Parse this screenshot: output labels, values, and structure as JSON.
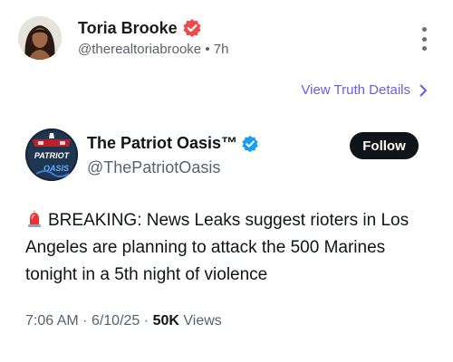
{
  "post": {
    "author_name": "Toria Brooke",
    "author_handle": "@therealtoriabrooke",
    "separator": "•",
    "time_ago": "7h",
    "more_icon": "more-vertical-icon",
    "verified_icon": "verified-badge-icon",
    "verified_color": "#ec4c4c"
  },
  "truth_link": {
    "label": "View Truth Details",
    "icon": "chevron-right-icon",
    "color": "#6b5ce7"
  },
  "tweet": {
    "author_name": "The Patriot Oasis™",
    "author_handle": "@ThePatriotOasis",
    "verified_icon": "verified-badge-icon",
    "verified_color": "#1d9bf0",
    "follow_label": "Follow",
    "avatar_text_top": "PATRIOT",
    "avatar_text_bottom": "OASIS",
    "siren_icon": "siren-icon",
    "text": "BREAKING: News Leaks suggest rioters in Los Angeles are planning to attack the 500 Marines tonight in a 5th night of violence",
    "time": "7:06 AM",
    "date": "6/10/25",
    "dot": "·",
    "views_count": "50K",
    "views_label": "Views"
  }
}
